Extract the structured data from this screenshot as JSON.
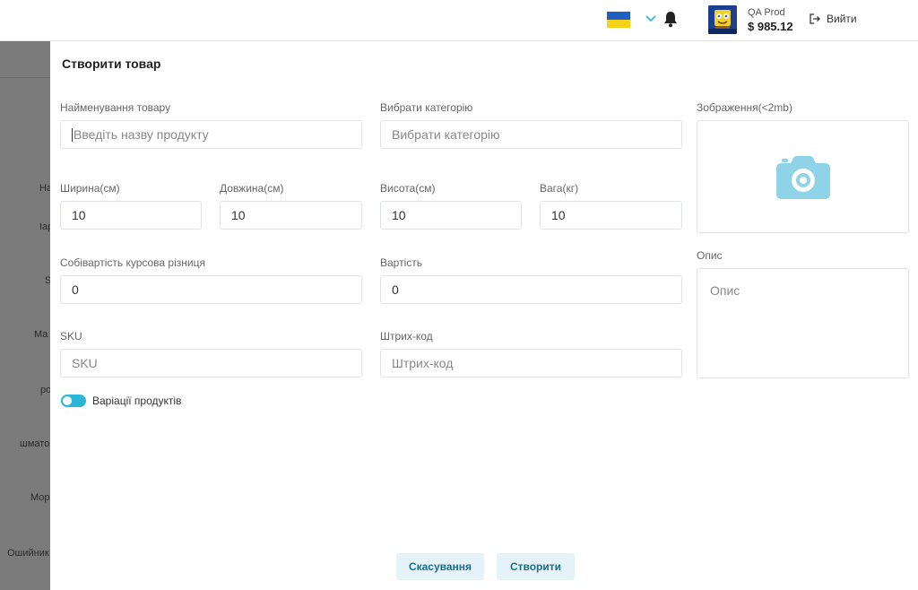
{
  "header": {
    "account_name": "QA Prod",
    "balance": "$ 985.12",
    "logout_label": "Вийти",
    "flag_colors": [
      "#1e5fbf",
      "#f7d21b"
    ]
  },
  "background_page": {
    "items": [
      "На",
      "Іар",
      "S",
      "Ма",
      "ро",
      "шмато",
      "Мор",
      "Ошийник"
    ]
  },
  "form": {
    "title": "Створити товар",
    "product_name": {
      "label": "Найменування товару",
      "placeholder": "Введіть назву продукту"
    },
    "category": {
      "label": "Вибрати категорію",
      "placeholder": "Вибрати категорію"
    },
    "image": {
      "label": "Зображення(<2mb)",
      "icon": "camera-icon"
    },
    "width": {
      "label": "Ширина(см)",
      "value": "10"
    },
    "length": {
      "label": "Довжина(см)",
      "value": "10"
    },
    "height": {
      "label": "Висота(см)",
      "value": "10"
    },
    "weight": {
      "label": "Вага(кг)",
      "value": "10"
    },
    "cost_diff": {
      "label": "Собівартість курсова різниця",
      "value": "0"
    },
    "cost": {
      "label": "Вартість",
      "value": "0"
    },
    "description": {
      "label": "Опис",
      "placeholder": "Опис"
    },
    "sku": {
      "label": "SKU",
      "placeholder": "SKU"
    },
    "barcode": {
      "label": "Штрих-код",
      "placeholder": "Штрих-код"
    },
    "variations": {
      "label": "Варіації продуктів",
      "enabled": true
    },
    "cancel_label": "Скасування",
    "create_label": "Створити"
  },
  "colors": {
    "accent": "#29b6d8",
    "camera": "#8fd3e8",
    "button_bg": "#e5f2f7",
    "button_text": "#1f6c8a"
  }
}
